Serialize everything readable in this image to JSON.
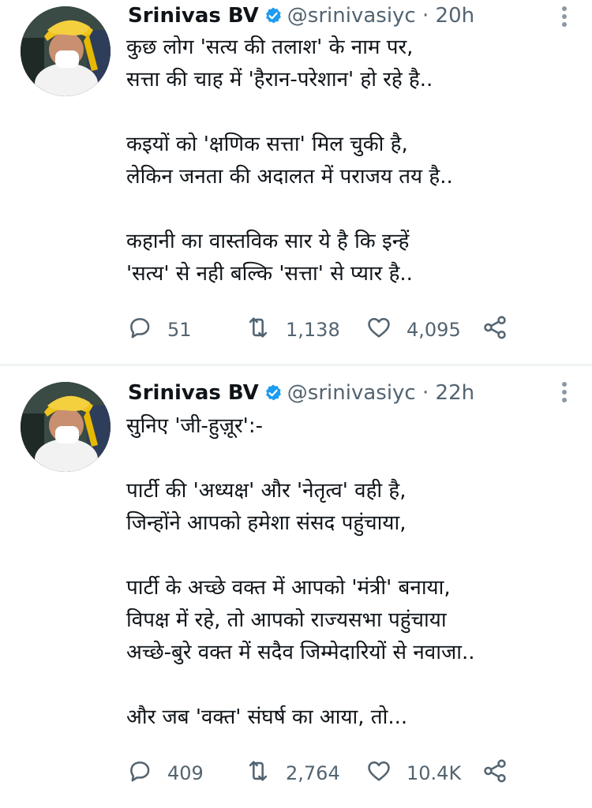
{
  "tweets": [
    {
      "name": "Srinivas BV",
      "handle": "@srinivasiyc",
      "separator": "·",
      "time": "20h",
      "lines": [
        "कुछ लोग 'सत्य की तलाश' के नाम पर,",
        "सत्ता की चाह में 'हैरान-परेशान' हो रहे है..",
        "",
        "कइयों को 'क्षणिक सत्ता' मिल चुकी है,",
        "लेकिन जनता की अदालत में पराजय तय है..",
        "",
        "कहानी का वास्तविक सार ये है कि इन्हें",
        "'सत्य' से नही बल्कि 'सत्ता' से प्यार है.."
      ],
      "replies": "51",
      "retweets": "1,138",
      "likes": "4,095"
    },
    {
      "name": "Srinivas BV",
      "handle": "@srinivasiyc",
      "separator": "·",
      "time": "22h",
      "lines": [
        "सुनिए 'जी-हुज़ूर':-",
        "",
        "पार्टी की 'अध्यक्ष' और 'नेतृत्व' वही है,",
        "जिन्होंने आपको हमेशा संसद पहुंचाया,",
        "",
        "पार्टी के अच्छे वक्त में आपको 'मंत्री' बनाया,",
        "विपक्ष में रहे, तो आपको राज्यसभा पहुंचाया",
        "अच्छे-बुरे वक्त में सदैव जिम्मेदारियों से नवाजा..",
        "",
        "और जब 'वक्त' संघर्ष का आया, तो..."
      ],
      "replies": "409",
      "retweets": "2,764",
      "likes": "10.4K"
    }
  ],
  "icons": {
    "verified": "verified-badge-icon",
    "more": "more-vertical-icon",
    "reply": "reply-icon",
    "retweet": "retweet-icon",
    "like": "heart-icon",
    "share": "share-icon"
  },
  "colors": {
    "verified": "#1d9bf0",
    "secondary_text": "#536471",
    "primary_text": "#0f1419",
    "divider": "#eff3f4"
  }
}
